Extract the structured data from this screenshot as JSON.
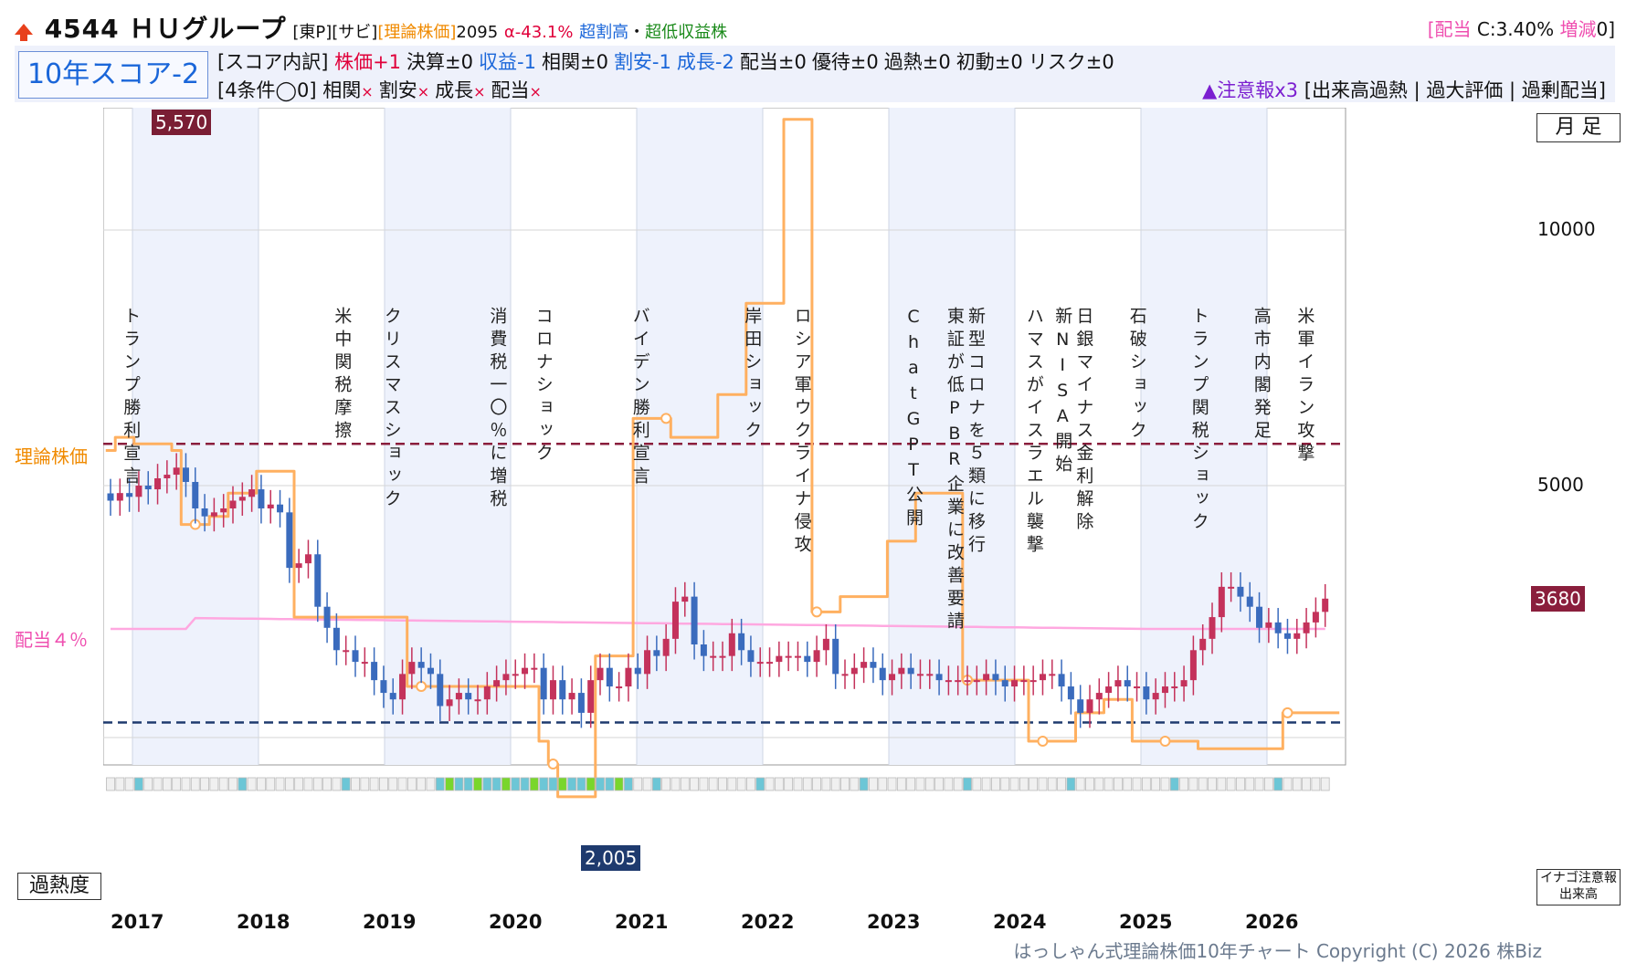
{
  "header": {
    "title": "4544 ＨＵグループ",
    "market": "[東P]",
    "sector": "[サビ]",
    "theory_label": "[理論株価]",
    "theory_value": "2095",
    "alpha": "α-43.1%",
    "tag1": "超割高",
    "dot": "・",
    "tag2": "超低収益株",
    "div_open": "[",
    "div_label": "配当",
    "div_value": " C:3.40% ",
    "inc_label": "増減",
    "inc_value": "0]"
  },
  "score": {
    "box": "10年スコア-2",
    "breakdown_label": "[スコア内訳]",
    "items": [
      {
        "label": "株価+1",
        "color": "#e0003a"
      },
      {
        "label": "決算±0",
        "color": "#111111"
      },
      {
        "label": "収益-1",
        "color": "#1a66d9"
      },
      {
        "label": "相関±0",
        "color": "#111111"
      },
      {
        "label": "割安-1",
        "color": "#1a66d9"
      },
      {
        "label": "成長-2",
        "color": "#1a66d9"
      },
      {
        "label": "配当±0",
        "color": "#111111"
      },
      {
        "label": "優待±0",
        "color": "#111111"
      },
      {
        "label": "過熱±0",
        "color": "#111111"
      },
      {
        "label": "初動±0",
        "color": "#111111"
      },
      {
        "label": "リスク±0",
        "color": "#111111"
      }
    ],
    "cond_label": "[4条件◯0]",
    "conds": [
      "相関",
      "割安",
      "成長",
      "配当"
    ],
    "cross": "×",
    "alert_label": "▲注意報x3",
    "alerts": "[出来高過熱 | 過大評価 | 過剰配当]"
  },
  "chart_data": {
    "type": "candlestick",
    "title": "はっしゃん式理論株価10年チャート",
    "period": "月足",
    "y_scale": "log",
    "y_ticks": [
      10000,
      5000
    ],
    "y_tick_labels": [
      "10000",
      "5000"
    ],
    "max_label": "5,570",
    "min_label": "2,005",
    "current_label": "3680",
    "theory_line_label": "理論株価",
    "theory_line_value": 5600,
    "dividend_line_label": "配当４％",
    "support_line_value": 2630,
    "years": [
      "2017",
      "2018",
      "2019",
      "2020",
      "2021",
      "2022",
      "2023",
      "2024",
      "2025",
      "2026"
    ],
    "closes": [
      4800,
      4900,
      4850,
      5000,
      4950,
      5100,
      5150,
      5250,
      5050,
      4700,
      4600,
      4650,
      4700,
      4800,
      4850,
      4950,
      4700,
      4750,
      4650,
      4000,
      4050,
      4150,
      3600,
      3400,
      3200,
      3200,
      3100,
      3100,
      2950,
      2850,
      2800,
      3000,
      3100,
      3050,
      3000,
      2750,
      2800,
      2850,
      2800,
      2800,
      2900,
      2950,
      3000,
      3000,
      3050,
      3050,
      2800,
      2950,
      2800,
      2850,
      2700,
      2950,
      3050,
      2900,
      2900,
      3050,
      3000,
      3200,
      3150,
      3300,
      3650,
      3700,
      3250,
      3150,
      3150,
      3150,
      3350,
      3200,
      3100,
      3100,
      3100,
      3150,
      3150,
      3150,
      3100,
      3200,
      3300,
      3000,
      3000,
      3050,
      3100,
      3050,
      2950,
      3000,
      3050,
      3000,
      3000,
      3000,
      2950,
      2950,
      2950,
      2950,
      2950,
      3000,
      2950,
      2900,
      2950,
      2950,
      2950,
      3000,
      3000,
      2900,
      2800,
      2700,
      2800,
      2850,
      2900,
      2950,
      2900,
      2900,
      2800,
      2850,
      2900,
      2900,
      2950,
      3200,
      3300,
      3500,
      3800,
      3800,
      3700,
      3600,
      3400,
      3450,
      3350,
      3300,
      3350,
      3450,
      3550,
      3680
    ],
    "theory_values": [
      5500,
      5700,
      5700,
      5600,
      5600,
      5600,
      5600,
      5500,
      4500,
      4500,
      4500,
      4600,
      4600,
      4900,
      4900,
      4900,
      5200,
      5200,
      5200,
      5200,
      3500,
      3500,
      3500,
      3500,
      3500,
      3500,
      3500,
      3500,
      3500,
      3500,
      3500,
      3500,
      2900,
      2900,
      2900,
      2900,
      2900,
      2900,
      2900,
      2900,
      2900,
      2900,
      2900,
      2900,
      2900,
      2900,
      2500,
      2350,
      2150,
      2150,
      2150,
      2150,
      3150,
      3150,
      3150,
      3150,
      6000,
      6000,
      6000,
      6000,
      5700,
      5700,
      5700,
      5700,
      5700,
      6400,
      6400,
      6400,
      8200,
      8200,
      8200,
      8200,
      13500,
      13500,
      13500,
      3550,
      3550,
      3550,
      3700,
      3700,
      3700,
      3700,
      3700,
      4300,
      4300,
      4300,
      4900,
      4900,
      4900,
      4900,
      4900,
      2950,
      2950,
      2950,
      2950,
      2950,
      2950,
      2950,
      2500,
      2500,
      2500,
      2500,
      2500,
      2700,
      2700,
      2700,
      2800,
      2800,
      2800,
      2500,
      2500,
      2500,
      2500,
      2500,
      2500,
      2500,
      2450,
      2450,
      2450,
      2450,
      2450,
      2450,
      2450,
      2450,
      2450,
      2700,
      2700,
      2700,
      2700,
      2700,
      2700
    ],
    "events": [
      {
        "label": "トランプ勝利宣言",
        "x": 0.02
      },
      {
        "label": "米中関税摩擦",
        "x": 0.19
      },
      {
        "label": "クリスマスショック",
        "x": 0.23
      },
      {
        "label": "消費税一〇％に増税",
        "x": 0.315
      },
      {
        "label": "コロナショック",
        "x": 0.352
      },
      {
        "label": "バイデン勝利宣言",
        "x": 0.43
      },
      {
        "label": "岸田ショック",
        "x": 0.52
      },
      {
        "label": "ロシア軍ウクライナ侵攻",
        "x": 0.56
      },
      {
        "label": "ChatGPT公開",
        "x": 0.65
      },
      {
        "label": "東証が低PBR企業に改善要請",
        "x": 0.683
      },
      {
        "label": "新型コロナを５類に移行",
        "x": 0.7
      },
      {
        "label": "ハマスがイスラエル襲撃",
        "x": 0.747
      },
      {
        "label": "新NISA開始",
        "x": 0.77
      },
      {
        "label": "日銀マイナス金利解除",
        "x": 0.787
      },
      {
        "label": "石破ショック",
        "x": 0.83
      },
      {
        "label": "トランプ関税ショック",
        "x": 0.88
      },
      {
        "label": "高市内閣発足",
        "x": 0.93
      },
      {
        "label": "米軍イラン攻撃",
        "x": 0.965
      }
    ]
  },
  "labels": {
    "monthly": "月 足",
    "heat": "過熱度",
    "inago_line1": "イナゴ注意報",
    "inago_line2": "出来高",
    "copyright": "はっしゃん式理論株価10年チャート Copyright (C) 2026 株Biz"
  },
  "colors": {
    "up": "#c4325b",
    "down": "#3a6bbd",
    "theory": "#ffb060",
    "dividend": "#ffa8e0",
    "resist": "#8a1e3c",
    "support": "#1e3a6e",
    "heat_normal": "#f0f0f0",
    "heat_warm": "#6cc6d6",
    "heat_hot": "#79d62c"
  }
}
